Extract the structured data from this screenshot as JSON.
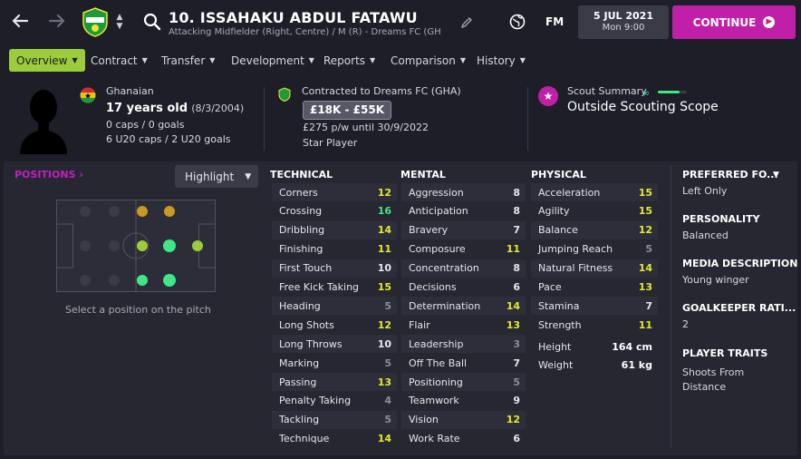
{
  "header": {
    "player_title": "10. ISSAHAKU ABDUL FATAWU",
    "subtitle": "Attacking Midfielder (Right, Centre) / M (R) - Dreams FC (GHA)...",
    "fm_label": "FM",
    "date": "5 JUL 2021",
    "time": "Mon 9:00",
    "continue_label": "CONTINUE"
  },
  "tabs": [
    {
      "label": "Overview",
      "active": true
    },
    {
      "label": "Contract"
    },
    {
      "label": "Transfer"
    },
    {
      "label": "Development"
    },
    {
      "label": "Reports"
    },
    {
      "label": "Comparison"
    },
    {
      "label": "History"
    }
  ],
  "profile": {
    "nationality": "Ghanaian",
    "age": "17 years old",
    "dob": "(8/3/2004)",
    "caps": "0 caps / 0 goals",
    "u20": "6 U20 caps / 2 U20 goals",
    "contract": "Contracted to Dreams FC (GHA)",
    "value": "£18K - £55K",
    "wage": "£275 p/w until 30/9/2022",
    "status": "Star Player",
    "scout_label": "Scout Summary",
    "scout_value": "Outside Scouting Scope",
    "scout_level": 0.75
  },
  "positions": {
    "title": "POSITIONS",
    "highlight_label": "Highlight",
    "hint": "Select a position on the pitch"
  },
  "technical": {
    "title": "TECHNICAL",
    "rows": [
      {
        "name": "Corners",
        "value": "12"
      },
      {
        "name": "Crossing",
        "value": "16"
      },
      {
        "name": "Dribbling",
        "value": "14"
      },
      {
        "name": "Finishing",
        "value": "11"
      },
      {
        "name": "First Touch",
        "value": "10"
      },
      {
        "name": "Free Kick Taking",
        "value": "15"
      },
      {
        "name": "Heading",
        "value": "5"
      },
      {
        "name": "Long Shots",
        "value": "12"
      },
      {
        "name": "Long Throws",
        "value": "10"
      },
      {
        "name": "Marking",
        "value": "5"
      },
      {
        "name": "Passing",
        "value": "13"
      },
      {
        "name": "Penalty Taking",
        "value": "4"
      },
      {
        "name": "Tackling",
        "value": "5"
      },
      {
        "name": "Technique",
        "value": "14"
      }
    ]
  },
  "mental": {
    "title": "MENTAL",
    "rows": [
      {
        "name": "Aggression",
        "value": "8"
      },
      {
        "name": "Anticipation",
        "value": "8"
      },
      {
        "name": "Bravery",
        "value": "7"
      },
      {
        "name": "Composure",
        "value": "11"
      },
      {
        "name": "Concentration",
        "value": "8"
      },
      {
        "name": "Decisions",
        "value": "6"
      },
      {
        "name": "Determination",
        "value": "14"
      },
      {
        "name": "Flair",
        "value": "13"
      },
      {
        "name": "Leadership",
        "value": "3"
      },
      {
        "name": "Off The Ball",
        "value": "7"
      },
      {
        "name": "Positioning",
        "value": "5"
      },
      {
        "name": "Teamwork",
        "value": "9"
      },
      {
        "name": "Vision",
        "value": "12"
      },
      {
        "name": "Work Rate",
        "value": "6"
      }
    ]
  },
  "physical": {
    "title": "PHYSICAL",
    "rows": [
      {
        "name": "Acceleration",
        "value": "15"
      },
      {
        "name": "Agility",
        "value": "15"
      },
      {
        "name": "Balance",
        "value": "12"
      },
      {
        "name": "Jumping Reach",
        "value": "5"
      },
      {
        "name": "Natural Fitness",
        "value": "14"
      },
      {
        "name": "Pace",
        "value": "13"
      },
      {
        "name": "Stamina",
        "value": "7"
      },
      {
        "name": "Strength",
        "value": "11"
      }
    ],
    "height_label": "Height",
    "height": "164 cm",
    "weight_label": "Weight",
    "weight": "61 kg"
  },
  "side": {
    "preferred_foot_title": "PREFERRED FO...",
    "preferred_foot": "Left Only",
    "personality_title": "PERSONALITY",
    "personality": "Balanced",
    "media_title": "MEDIA DESCRIPTION",
    "media": "Young winger",
    "gk_title": "GOALKEEPER RATI...",
    "gk": "2",
    "traits_title": "PLAYER TRAITS",
    "traits": "Shoots From",
    "traits_2": "Distance"
  },
  "colors": {
    "accent": "#c020a8",
    "tab_active": "#9ccc3c",
    "attr_high": "#3ee886",
    "attr_good": "#e8e832",
    "attr_mid": "#e6e6ea",
    "attr_low": "#8b8d9a"
  }
}
